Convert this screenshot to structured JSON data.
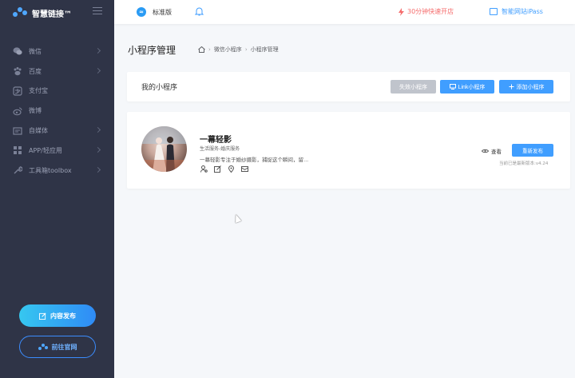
{
  "sidebar": {
    "logo_text": "智慧链接™",
    "items": [
      {
        "label": "微信",
        "icon": "wechat-icon"
      },
      {
        "label": "百度",
        "icon": "baidu-icon"
      },
      {
        "label": "支付宝",
        "icon": "alipay-icon"
      },
      {
        "label": "微博",
        "icon": "weibo-icon"
      },
      {
        "label": "自媒体",
        "icon": "media-icon"
      },
      {
        "label": "APP/轻应用",
        "icon": "app-icon"
      },
      {
        "label": "工具箱toolbox",
        "icon": "wrench-icon"
      }
    ],
    "publish_label": "内容发布",
    "site_label": "前往官网"
  },
  "topbar": {
    "edition_label": "标准版",
    "quick_label": "30分钟快速开店",
    "ipass_label": "智能网站iPass"
  },
  "page": {
    "title": "小程序管理",
    "breadcrumb": [
      "微信小程序",
      "小程序管理"
    ]
  },
  "mini_programs": {
    "title": "我的小程序",
    "fail_label": "失效小程序",
    "link_label": "Link小程序",
    "add_label": "添加小程序"
  },
  "app": {
    "name": "一幕轻影",
    "category": "生活服务-婚庆服务",
    "description": "一幕轻影专注于婚纱摄影，捕捉这个瞬间，留...",
    "view_label": "查看",
    "republish_label": "重新发布",
    "version": "当前已是最新版本:v4.24"
  },
  "colors": {
    "sidebar_bg": "#2f3447",
    "primary": "#409eff",
    "danger": "#f56c6c",
    "disabled": "#c0c4cc"
  }
}
